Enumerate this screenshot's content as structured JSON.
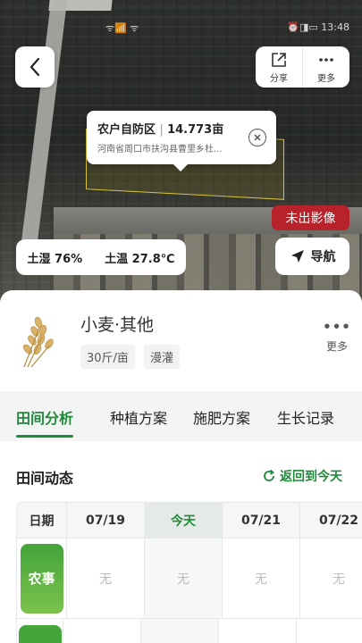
{
  "status_bar": {
    "signal": "ᯤ📶 ᯤ",
    "right_icons": "⏰◨▭",
    "time": "13:48"
  },
  "header": {
    "share_label": "分享",
    "more_label": "更多"
  },
  "field_popup": {
    "name": "农户自防区",
    "area": "14.773亩",
    "address": "河南省周口市扶沟县曹里乡杜..."
  },
  "map_badge": {
    "label": "未出影像",
    "color": "#b8232b"
  },
  "soil_info": {
    "moisture": "土湿 76%",
    "temperature": "土温 27.8℃"
  },
  "navigate_label": "导航",
  "crop": {
    "name": "小麦·其他",
    "tags": [
      "30斤/亩",
      "漫灌"
    ],
    "more_label": "更多"
  },
  "tabs": [
    "田间分析",
    "种植方案",
    "施肥方案",
    "生长记录"
  ],
  "accent_color": "#1f8a3a",
  "field_dynamics": {
    "title": "田间动态",
    "back_today_label": "返回到今天",
    "date_header": "日期",
    "dates": [
      "07/19",
      "今天",
      "07/21",
      "07/22"
    ],
    "row_label": "农事",
    "row_values": [
      "无",
      "无",
      "无",
      "无"
    ]
  }
}
